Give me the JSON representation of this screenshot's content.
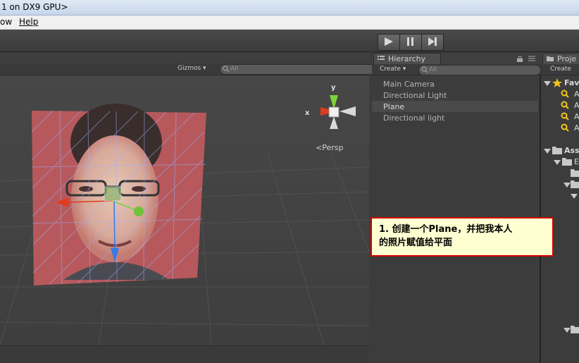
{
  "window": {
    "title": "1 on DX9 GPU>"
  },
  "menu": {
    "items": [
      "ow",
      "Help"
    ]
  },
  "toolbar": {
    "play_icon": "play-icon",
    "pause_icon": "pause-icon",
    "step_icon": "step-icon"
  },
  "scene": {
    "gizmos_label": "Gizmos",
    "search_placeholder": "All",
    "view_label": "Persp",
    "axes": {
      "x": "x",
      "y": "y"
    }
  },
  "hierarchy": {
    "tab_label": "Hierarchy",
    "create_label": "Create",
    "search_placeholder": "All",
    "items": [
      "Main Camera",
      "Directional Light",
      "Plane",
      "Directional light"
    ],
    "selected_index": 2
  },
  "project": {
    "tab_label": "Proje",
    "create_label": "Create",
    "favorites_label": "Fav",
    "fav_items": [
      "A",
      "A",
      "A",
      "A"
    ],
    "assets_label": "Ass",
    "asset_child": "E"
  },
  "annotation": {
    "line1": "1. 创建一个Plane，并把我本人",
    "line2": "的照片赋值给平面"
  },
  "colors": {
    "note_bg": "#ffffd2",
    "note_border": "#d40000",
    "x_axis": "#e23a1a",
    "y_axis": "#7ed23a",
    "z_axis": "#3a78e2"
  }
}
